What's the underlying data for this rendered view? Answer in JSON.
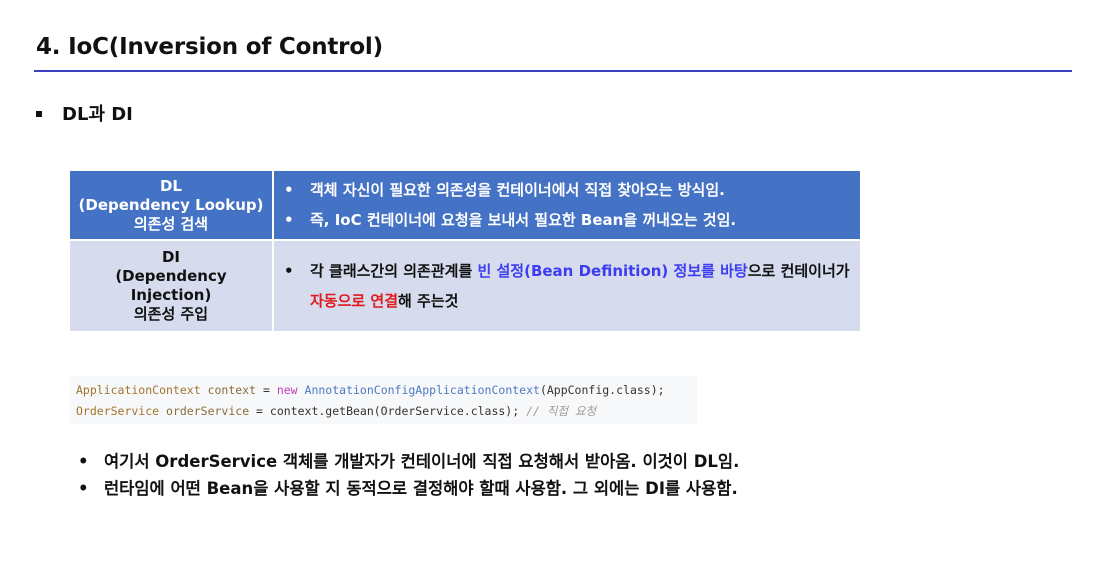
{
  "header": {
    "title": "4. IoC(Inversion of Control)",
    "accent_color": "#3b3fbf"
  },
  "section": {
    "heading": "DL과 DI"
  },
  "table": {
    "rows": [
      {
        "label_lines": [
          "DL",
          "(Dependency Lookup)",
          "의존성 검색"
        ],
        "bullets": [
          "객체 자신이 필요한 의존성을 컨테이너에서 직접 찾아오는 방식임.",
          "즉, IoC 컨테이너에 요청을 보내서 필요한 Bean을 꺼내오는 것임."
        ],
        "background": "#4472c4"
      },
      {
        "label_lines": [
          "DI",
          "(Dependency",
          "Injection)",
          "의존성 주입"
        ],
        "bullet_parts": {
          "p1": "각 클래스간의 의존관계를 ",
          "h1": "빈 설정(Bean Definition) 정보를 바탕",
          "p2": "으로 컨테이너가 ",
          "h2": "자동으로 연결",
          "p3": "해 주는것"
        },
        "background": "#d6dcee"
      }
    ]
  },
  "code": {
    "line1": {
      "type": "ApplicationContext",
      "var": "context",
      "op": " = ",
      "kw": "new",
      "cls": "AnnotationConfigApplicationContext",
      "rest": "(AppConfig.class);"
    },
    "line2": {
      "type": "OrderService",
      "var": "orderService",
      "op": " = ",
      "rest": "context.getBean(OrderService.class); ",
      "comment": "// 직접 요청"
    }
  },
  "notes": [
    "여기서 OrderService 객체를 개발자가 컨테이너에 직접 요청해서 받아옴. 이것이 DL임.",
    "런타임에 어떤 Bean을 사용할 지 동적으로 결정해야 할때 사용함. 그 외에는 DI를 사용함."
  ]
}
